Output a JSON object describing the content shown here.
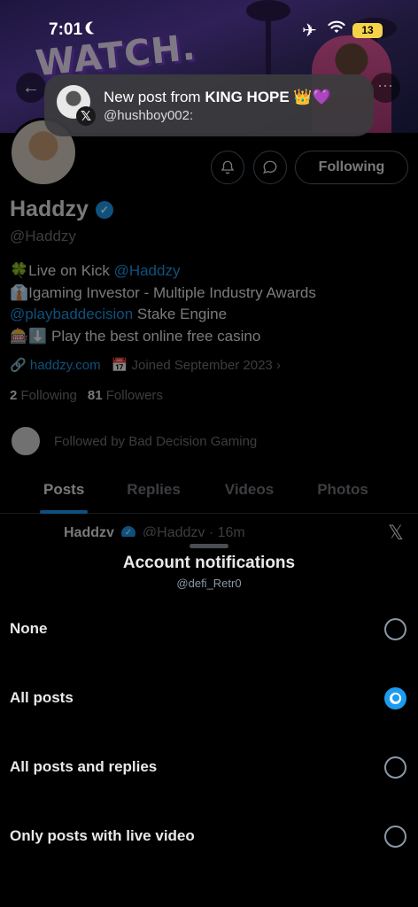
{
  "status_bar": {
    "time": "7:01",
    "battery": "13"
  },
  "notification": {
    "title_prefix": "New post from ",
    "title_name": "KING HOPE 👑💜",
    "subtitle": "@hushboy002:"
  },
  "profile": {
    "banner_text": "WATCH.",
    "following_label": "Following",
    "name": "Haddzy",
    "handle": "@Haddzy",
    "bio": {
      "line1_prefix": "🍀Live on Kick ",
      "line1_link": "@Haddzy",
      "line2": "👔Igaming Investor - Multiple Industry Awards",
      "line3_link": "@playbaddecision",
      "line3_suffix": " Stake Engine",
      "line4": "🎰⬇️ Play the best online free casino"
    },
    "website": "haddzy.com",
    "joined": "Joined September 2023",
    "following_count": "2",
    "following_word": "Following",
    "followers_count": "81",
    "followers_word": "Followers",
    "followed_by": "Followed by Bad Decision Gaming",
    "tabs": [
      {
        "label": "Posts",
        "active": true
      },
      {
        "label": "Replies",
        "active": false
      },
      {
        "label": "Videos",
        "active": false
      },
      {
        "label": "Photos",
        "active": false
      }
    ],
    "post_peek": {
      "name": "Haddzy",
      "meta": "@Haddzy · 16m"
    }
  },
  "sheet": {
    "title": "Account notifications",
    "subtitle": "@defi_Retr0",
    "options": [
      {
        "label": "None",
        "selected": false
      },
      {
        "label": "All posts",
        "selected": true
      },
      {
        "label": "All posts and replies",
        "selected": false
      },
      {
        "label": "Only posts with live video",
        "selected": false
      }
    ]
  },
  "colors": {
    "accent": "#1d9bf0",
    "background": "#000000",
    "muted": "#71767b"
  }
}
